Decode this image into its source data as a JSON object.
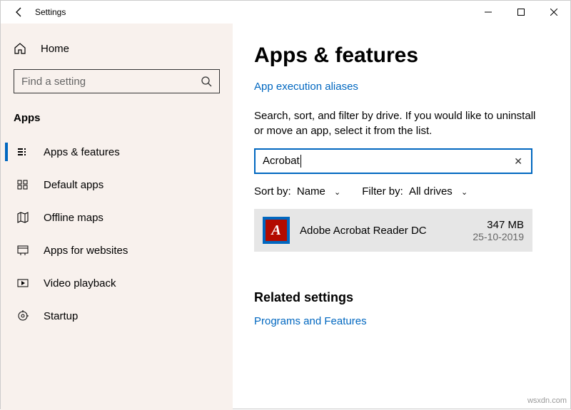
{
  "titlebar": {
    "title": "Settings"
  },
  "sidebar": {
    "home": "Home",
    "search_placeholder": "Find a setting",
    "category": "Apps",
    "items": [
      {
        "label": "Apps & features"
      },
      {
        "label": "Default apps"
      },
      {
        "label": "Offline maps"
      },
      {
        "label": "Apps for websites"
      },
      {
        "label": "Video playback"
      },
      {
        "label": "Startup"
      }
    ]
  },
  "main": {
    "heading": "Apps & features",
    "link_aliases": "App execution aliases",
    "helptext": "Search, sort, and filter by drive. If you would like to uninstall or move an app, select it from the list.",
    "search_value": "Acrobat",
    "sort_label": "Sort by:",
    "sort_value": "Name",
    "filter_label": "Filter by:",
    "filter_value": "All drives",
    "app": {
      "name": "Adobe Acrobat Reader DC",
      "size": "347 MB",
      "date": "25-10-2019",
      "icon_glyph": "A"
    },
    "related_heading": "Related settings",
    "related_link": "Programs and Features"
  },
  "watermark": "wsxdn.com"
}
